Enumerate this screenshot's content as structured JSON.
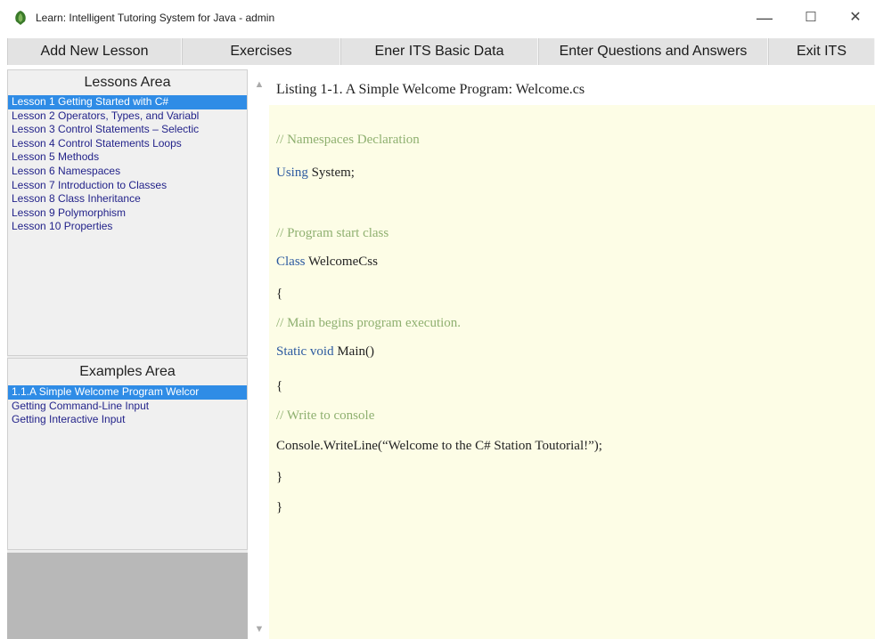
{
  "window": {
    "title": "Learn: Intelligent Tutoring System for Java  - admin",
    "minimize": "—",
    "maximize": "☐",
    "close": "✕"
  },
  "menu": {
    "items": [
      {
        "label": "Add New Lesson"
      },
      {
        "label": "Exercises"
      },
      {
        "label": "Ener ITS Basic Data"
      },
      {
        "label": "Enter Questions and Answers"
      },
      {
        "label": "Exit ITS"
      }
    ]
  },
  "lessons": {
    "heading": "Lessons Area",
    "items": [
      "Lesson 1 Getting Started with C#",
      "Lesson 2 Operators, Types, and Variabl",
      "Lesson 3 Control Statements – Selectic",
      "Lesson 4 Control Statements Loops",
      "Lesson 5  Methods",
      "Lesson 6 Namespaces",
      "Lesson 7 Introduction to Classes",
      "Lesson 8 Class Inheritance",
      "Lesson 9 Polymorphism",
      "Lesson 10 Properties"
    ],
    "selected_index": 0
  },
  "examples": {
    "heading": "Examples  Area",
    "items": [
      "1.1.A Simple Welcome Program Welcor",
      "Getting Command-Line Input",
      "Getting Interactive Input"
    ],
    "selected_index": 0
  },
  "content": {
    "listing_title": "Listing 1-1. A Simple Welcome Program: Welcome.cs",
    "code": {
      "comment_namespaces": "// Namespaces Declaration",
      "using_keyword": "Using",
      "using_rest": " System;",
      "comment_start": "// Program start class",
      "class_keyword": "Class",
      "class_rest": " WelcomeCss",
      "brace_open_1": "{",
      "comment_main": "// Main begins program execution.",
      "static_keyword": "Static void",
      "static_rest": " Main()",
      "brace_open_2": "{",
      "comment_console": "// Write to console",
      "console_line": "Console.WriteLine(“Welcome to the C# Station Toutorial!”);",
      "brace_close_1": "}",
      "brace_close_2": "}"
    }
  },
  "colors": {
    "selection": "#2f8ce6",
    "comment": "#8fb070",
    "keyword": "#2c5aa0",
    "content_bg": "#fdfde6"
  }
}
